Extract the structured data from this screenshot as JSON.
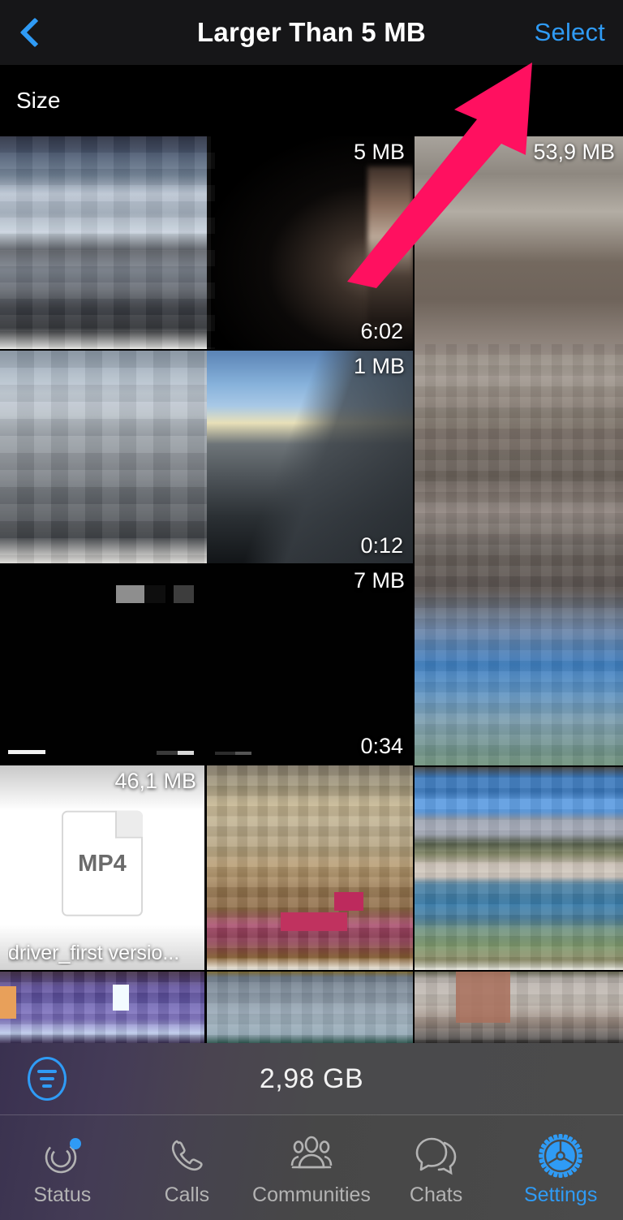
{
  "navbar": {
    "back_icon": "chevron-left-icon",
    "title": "Larger Than 5 MB",
    "select_label": "Select"
  },
  "section": {
    "header": "Size"
  },
  "annotation": {
    "type": "arrow",
    "color": "#FF1060",
    "points_to": "Select"
  },
  "grid": {
    "items": [
      {
        "size": "5 MB",
        "duration": "6:02",
        "kind": "video"
      },
      {
        "size": "53,9 MB",
        "duration": "",
        "kind": "photo"
      },
      {
        "size": "1 MB",
        "duration": "0:12",
        "kind": "video"
      },
      {
        "size": "7 MB",
        "duration": "0:34",
        "kind": "video"
      },
      {
        "size": "46,1 MB",
        "duration": "",
        "kind": "document",
        "filename": "driver_first versio...",
        "filetype": "MP4"
      },
      {
        "size": "",
        "duration": "",
        "kind": "photo"
      },
      {
        "size": "",
        "duration": "",
        "kind": "photo"
      },
      {
        "size": "",
        "duration": "",
        "kind": "photo"
      },
      {
        "size": "",
        "duration": "",
        "kind": "photo"
      },
      {
        "size": "",
        "duration": "",
        "kind": "photo"
      }
    ]
  },
  "total": {
    "sort_icon": "sort-filter-icon",
    "value": "2,98 GB"
  },
  "tabbar": {
    "items": [
      {
        "label": "Status",
        "icon": "status-rings-icon",
        "active": false,
        "badge": true
      },
      {
        "label": "Calls",
        "icon": "phone-icon",
        "active": false,
        "badge": false
      },
      {
        "label": "Communities",
        "icon": "communities-icon",
        "active": false,
        "badge": false
      },
      {
        "label": "Chats",
        "icon": "chat-bubbles-icon",
        "active": false,
        "badge": false
      },
      {
        "label": "Settings",
        "icon": "gear-icon",
        "active": true,
        "badge": false
      }
    ]
  },
  "colors": {
    "accent": "#2f9bf5",
    "annotation": "#FF1060",
    "navbar_bg": "#161618",
    "page_bg": "#000000",
    "inactive_tab": "#b3b3b3"
  }
}
